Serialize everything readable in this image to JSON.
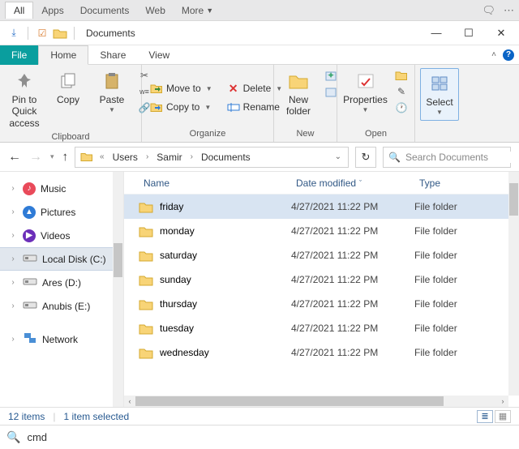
{
  "topbar": {
    "tabs": [
      "All",
      "Apps",
      "Documents",
      "Web"
    ],
    "more": "More"
  },
  "window": {
    "title": "Documents"
  },
  "ribbon": {
    "tabs": {
      "file": "File",
      "home": "Home",
      "share": "Share",
      "view": "View"
    },
    "clipboard": {
      "pin": "Pin to Quick\naccess",
      "copy": "Copy",
      "paste": "Paste",
      "label": "Clipboard"
    },
    "organize": {
      "move": "Move to",
      "copy": "Copy to",
      "delete": "Delete",
      "rename": "Rename",
      "label": "Organize"
    },
    "new": {
      "newfolder": "New\nfolder",
      "label": "New"
    },
    "open": {
      "properties": "Properties",
      "label": "Open"
    },
    "select": {
      "select": "Select",
      "label": ""
    }
  },
  "breadcrumb": {
    "items": [
      "Users",
      "Samir",
      "Documents"
    ]
  },
  "search": {
    "placeholder": "Search Documents"
  },
  "nav": {
    "items": [
      {
        "label": "Music",
        "icon": "music",
        "color": "#e94a5a"
      },
      {
        "label": "Pictures",
        "icon": "pictures",
        "color": "#2f7bd6"
      },
      {
        "label": "Videos",
        "icon": "videos",
        "color": "#6c2fb9"
      },
      {
        "label": "Local Disk (C:)",
        "icon": "disk",
        "selected": true
      },
      {
        "label": "Ares (D:)",
        "icon": "disk"
      },
      {
        "label": "Anubis (E:)",
        "icon": "disk"
      },
      {
        "label": "Network",
        "icon": "network",
        "spacer": true
      }
    ]
  },
  "columns": {
    "name": "Name",
    "date": "Date modified",
    "type": "Type"
  },
  "files": [
    {
      "name": "friday",
      "date": "4/27/2021 11:22 PM",
      "type": "File folder",
      "selected": true
    },
    {
      "name": "monday",
      "date": "4/27/2021 11:22 PM",
      "type": "File folder"
    },
    {
      "name": "saturday",
      "date": "4/27/2021 11:22 PM",
      "type": "File folder"
    },
    {
      "name": "sunday",
      "date": "4/27/2021 11:22 PM",
      "type": "File folder"
    },
    {
      "name": "thursday",
      "date": "4/27/2021 11:22 PM",
      "type": "File folder"
    },
    {
      "name": "tuesday",
      "date": "4/27/2021 11:22 PM",
      "type": "File folder"
    },
    {
      "name": "wednesday",
      "date": "4/27/2021 11:22 PM",
      "type": "File folder"
    }
  ],
  "status": {
    "count": "12 items",
    "selected": "1 item selected"
  },
  "run": {
    "value": "cmd"
  }
}
